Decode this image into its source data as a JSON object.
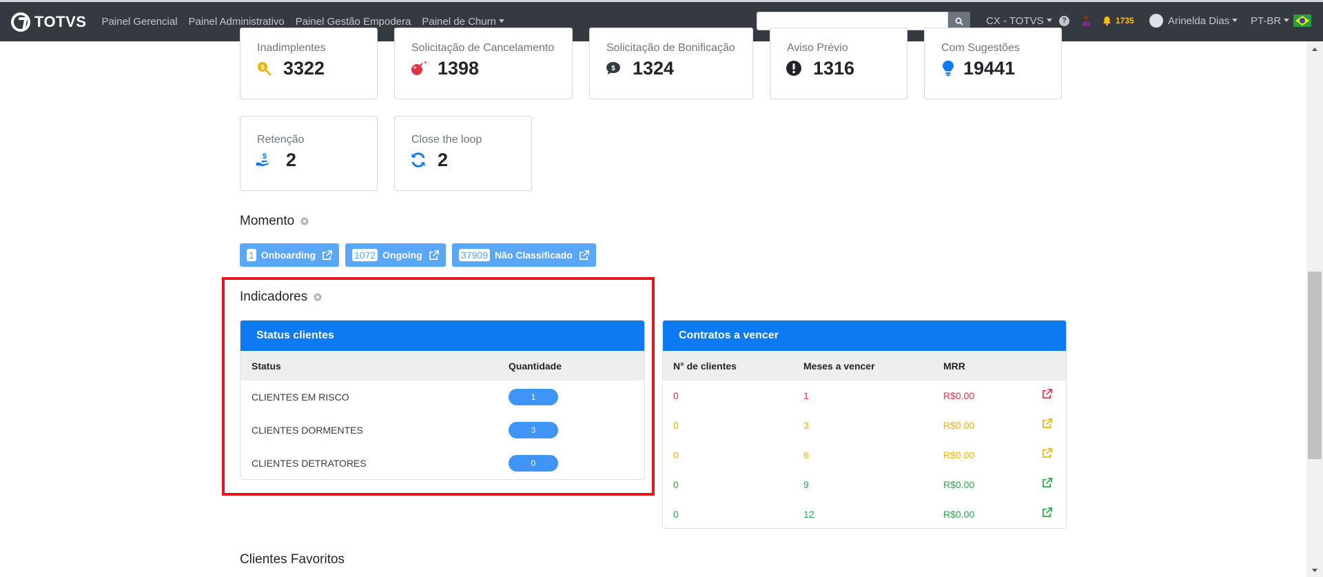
{
  "navbar": {
    "brand": "TOTVS",
    "links": [
      "Painel Gerencial",
      "Painel Administrativo",
      "Painel Gestão Empodera",
      "Painel de Churn"
    ],
    "search": {
      "value": "",
      "placeholder": ""
    },
    "org": "CX - TOTVS",
    "help": "?",
    "notifications": "1735",
    "user": "Arinelda Dias",
    "language": "PT-BR"
  },
  "cards": [
    {
      "label": "Inadimplentes",
      "value": "3322",
      "icon": "money-search-icon",
      "color": "#f0b400"
    },
    {
      "label": "Solicitação de Cancelamento",
      "value": "1398",
      "icon": "bomb-icon",
      "color": "#dc3545"
    },
    {
      "label": "Solicitação de Bonificação",
      "value": "1324",
      "icon": "money-comment-icon",
      "color": "#343a40"
    },
    {
      "label": "Aviso Prévio",
      "value": "1316",
      "icon": "exclamation-circle-icon",
      "color": "#212529"
    },
    {
      "label": "Com Sugestões",
      "value": "19441",
      "icon": "lightbulb-icon",
      "color": "#0d79f2"
    },
    {
      "label": "Retenção",
      "value": "2",
      "icon": "hand-holding-dollar-icon",
      "color": "#0d79f2"
    },
    {
      "label": "Close the loop",
      "value": "2",
      "icon": "sync-icon",
      "color": "#0d79f2"
    }
  ],
  "momento": {
    "title": "Momento",
    "items": [
      {
        "count": "1",
        "label": "Onboarding"
      },
      {
        "count": "1072",
        "label": "Ongoing"
      },
      {
        "count": "37909",
        "label": "Não Classificado"
      }
    ]
  },
  "indicadores": {
    "title": "Indicadores",
    "status_clientes": {
      "title": "Status clientes",
      "headers": [
        "Status",
        "Quantidade"
      ],
      "rows": [
        {
          "status": "CLIENTES EM RISCO",
          "quantidade": "1"
        },
        {
          "status": "CLIENTES DORMENTES",
          "quantidade": "3"
        },
        {
          "status": "CLIENTES DETRATORES",
          "quantidade": "0"
        }
      ]
    },
    "contratos": {
      "title": "Contratos a vencer",
      "headers": [
        "N° de clientes",
        "Meses a vencer",
        "MRR"
      ],
      "rows": [
        {
          "clientes": "0",
          "meses": "1",
          "mrr": "R$0.00",
          "color": "#dc3545"
        },
        {
          "clientes": "0",
          "meses": "3",
          "mrr": "R$0.00",
          "color": "#f0b400"
        },
        {
          "clientes": "0",
          "meses": "6",
          "mrr": "R$0.00",
          "color": "#f0b400"
        },
        {
          "clientes": "0",
          "meses": "9",
          "mrr": "R$0.00",
          "color": "#28a745"
        },
        {
          "clientes": "0",
          "meses": "12",
          "mrr": "R$0.00",
          "color": "#28a745"
        }
      ]
    }
  },
  "favoritos": {
    "title": "Clientes Favoritos"
  }
}
